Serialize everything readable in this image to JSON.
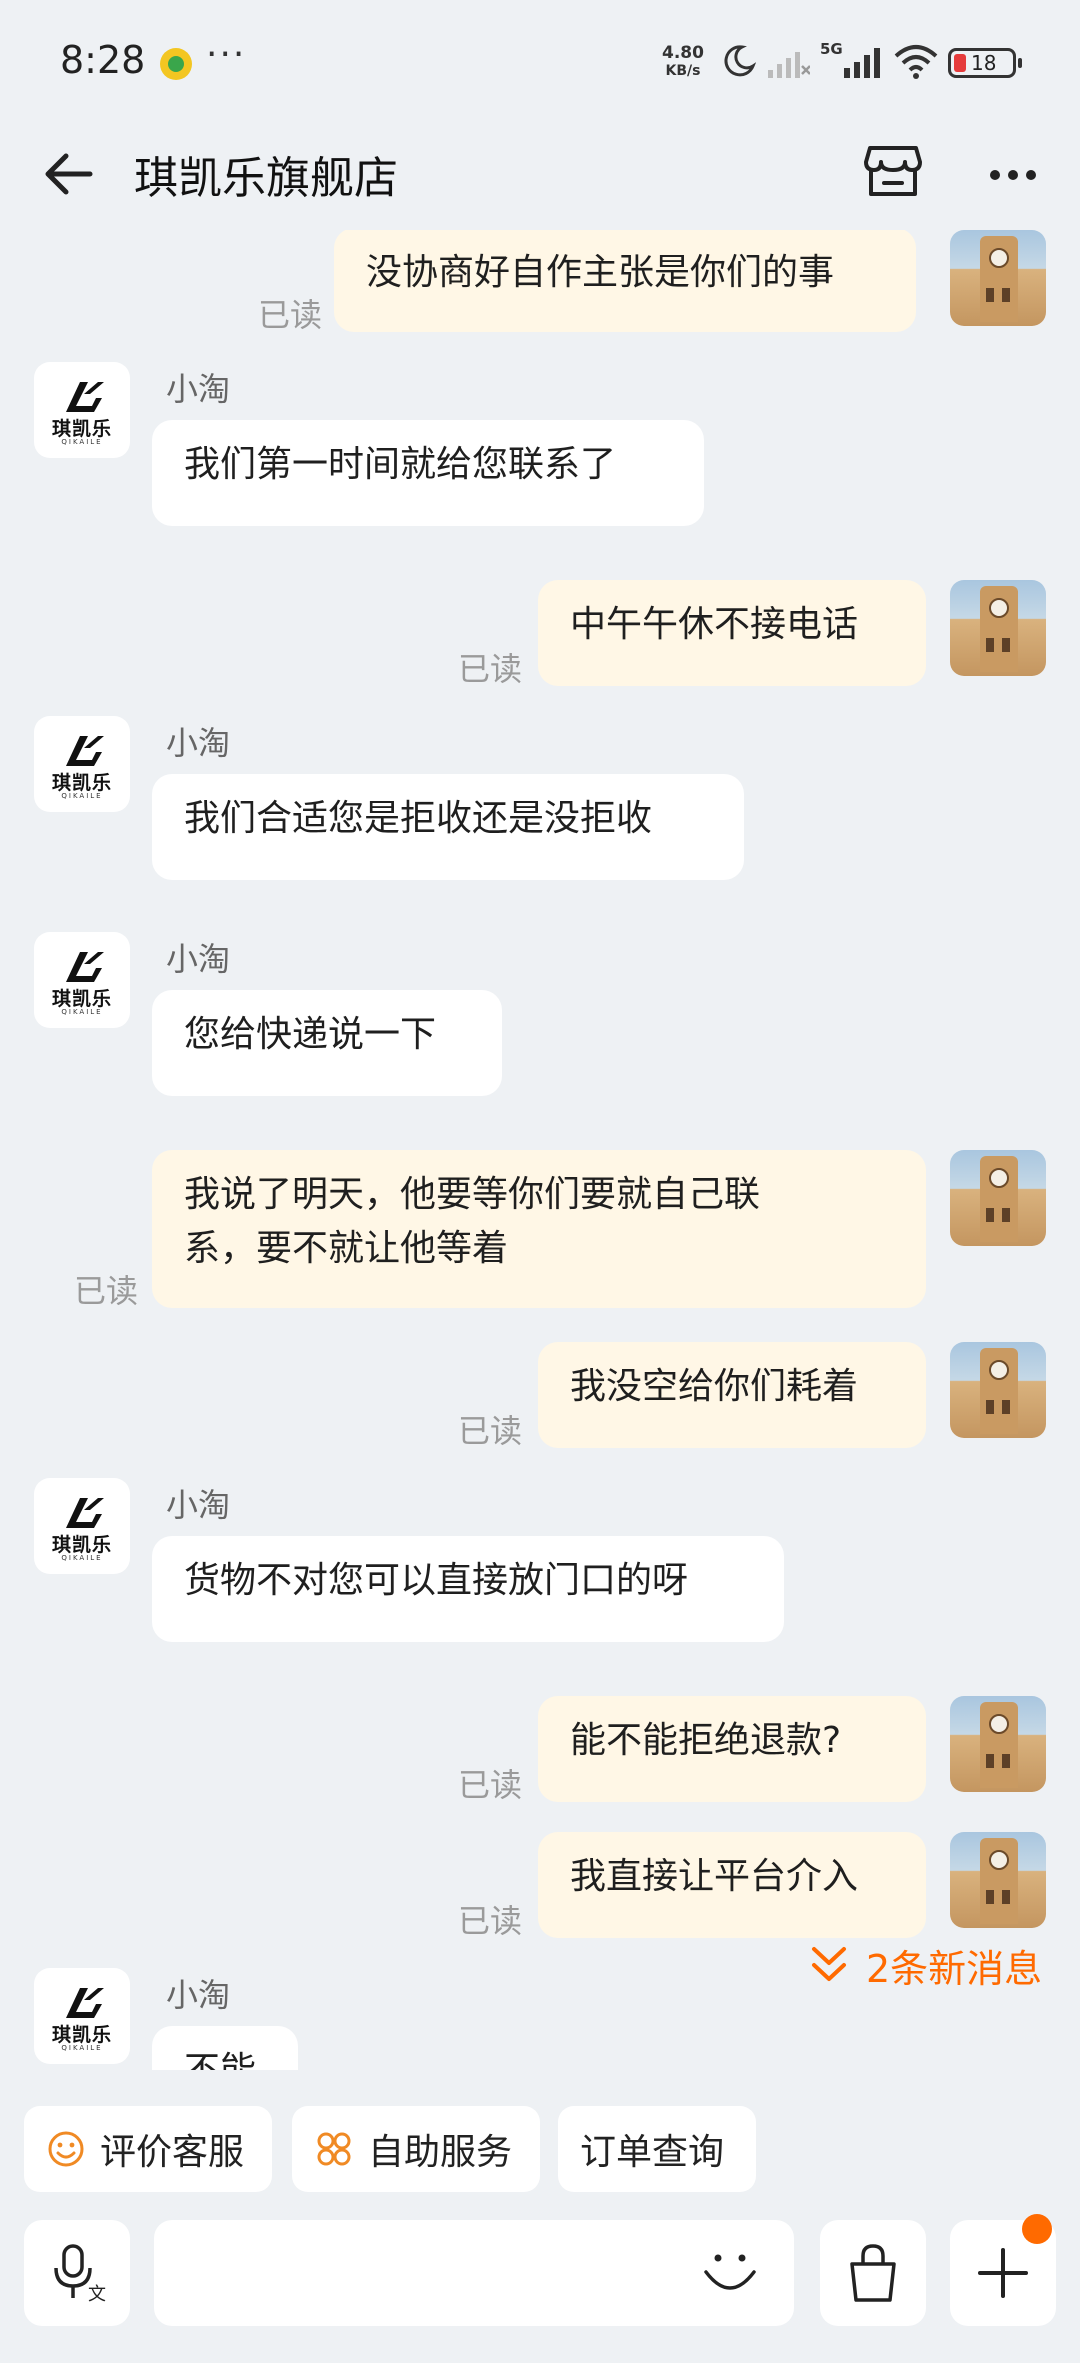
{
  "status_bar": {
    "time": "8:28",
    "more": "···",
    "net_speed_value": "4.80",
    "net_speed_unit": "KB/s",
    "network": "5G",
    "battery": "18"
  },
  "header": {
    "title": "琪凯乐旗舰店"
  },
  "shop_logo": {
    "name": "琪凯乐",
    "sub": "QIKAILE"
  },
  "messages": [
    {
      "from": "self",
      "text": "没协商好自作主张是你们的事",
      "read": "已读"
    },
    {
      "from": "other",
      "sender": "小淘",
      "text": "我们第一时间就给您联系了"
    },
    {
      "from": "self",
      "text": "中午午休不接电话",
      "read": "已读"
    },
    {
      "from": "other",
      "sender": "小淘",
      "text": "我们合适您是拒收还是没拒收"
    },
    {
      "from": "other",
      "sender": "小淘",
      "text": "您给快递说一下"
    },
    {
      "from": "self",
      "text_line1": "我说了明天，他要等你们要就自己联",
      "text_line2": "系，要不就让他等着",
      "read": "已读"
    },
    {
      "from": "self",
      "text": "我没空给你们耗着",
      "read": "已读"
    },
    {
      "from": "other",
      "sender": "小淘",
      "text": "货物不对您可以直接放门口的呀"
    },
    {
      "from": "self",
      "text": "能不能拒绝退款?",
      "read": "已读"
    },
    {
      "from": "self",
      "text": "我直接让平台介入",
      "read": "已读"
    },
    {
      "from": "other",
      "sender": "小淘",
      "text": "不能"
    }
  ],
  "new_messages": "2条新消息",
  "quick_actions": [
    {
      "label": "评价客服",
      "icon": "smile-icon"
    },
    {
      "label": "自助服务",
      "icon": "grid-dots-icon"
    },
    {
      "label": "订单查询",
      "icon": ""
    }
  ],
  "colors": {
    "accent": "#ff6a00",
    "self_bubble": "#fff7e6",
    "background": "#eef1f4"
  }
}
